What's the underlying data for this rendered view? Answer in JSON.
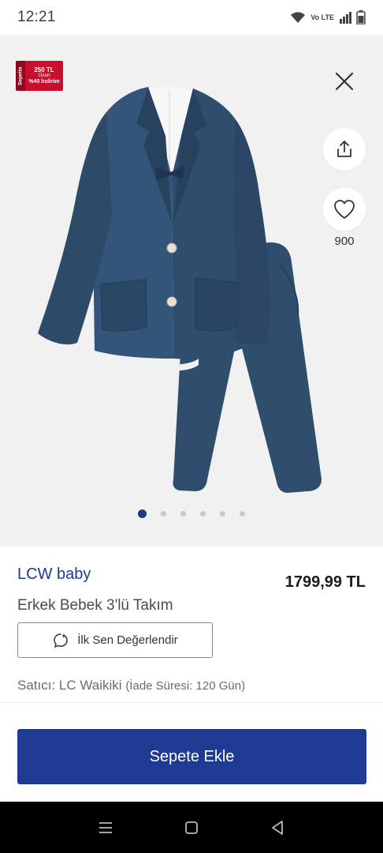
{
  "status_bar": {
    "time": "12:21",
    "network_label": "Vo LTE",
    "icons": [
      "wifi-icon",
      "signal-icon",
      "battery-icon"
    ]
  },
  "gallery": {
    "badge": {
      "side_text": "Sepette",
      "line1": "250 TL",
      "line2": "Üzeri",
      "line3": "%40 İndirim"
    },
    "favorite_count": "900",
    "image_count": 6,
    "active_index": 0
  },
  "product": {
    "brand": "LCW baby",
    "price": "1799,99 TL",
    "title": "Erkek Bebek 3'lü Takım",
    "review_label": "İlk Sen Değerlendir",
    "seller_prefix": "Satıcı: LC Waikiki",
    "seller_return": "(İade Süresi: 120 Gün)"
  },
  "cart": {
    "label": "Sepete Ekle"
  },
  "colors": {
    "brand_blue": "#1f3a93",
    "badge_red": "#c8102e",
    "suit_navy": "#2f4d6d"
  }
}
